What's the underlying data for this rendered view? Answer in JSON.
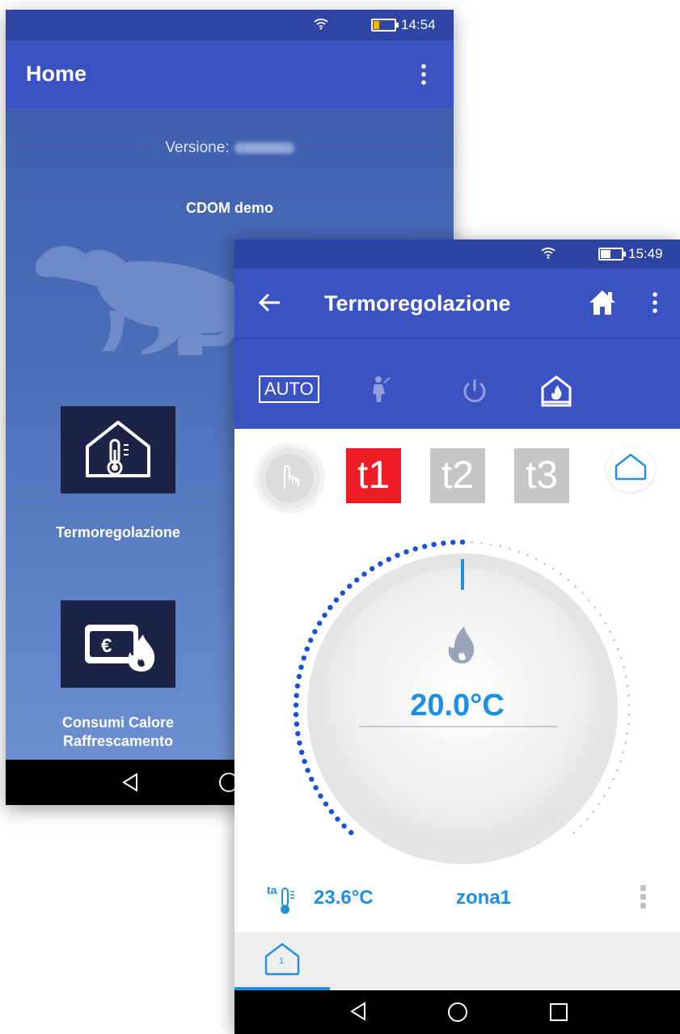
{
  "home": {
    "status_time": "14:54",
    "title": "Home",
    "version_label": "Versione:",
    "plant_name": "CDOM demo",
    "tiles": [
      {
        "label_line1": "Termoregolazione",
        "label_line2": "",
        "icon": "house-thermometer-icon"
      },
      {
        "label_line1": "Consumi Calore",
        "label_line2": "Raffrescamento",
        "icon": "wallet-euro-flame-icon"
      }
    ]
  },
  "thermo": {
    "status_time": "15:49",
    "title": "Termoregolazione",
    "modes": {
      "auto_label": "AUTO"
    },
    "timeslots": [
      {
        "label": "t1",
        "active": true,
        "color": "#ee1c24"
      },
      {
        "label": "t2",
        "active": false,
        "color": "#c6c6c6"
      },
      {
        "label": "t3",
        "active": false,
        "color": "#c6c6c6"
      }
    ],
    "setpoint": "20.0°C",
    "ambient_label": "ta",
    "ambient_temp": "23.6°C",
    "zone_name": "zona1",
    "zone_tab": "1",
    "accent": "#1d8fe0",
    "appbar_color": "#3b53c2"
  }
}
